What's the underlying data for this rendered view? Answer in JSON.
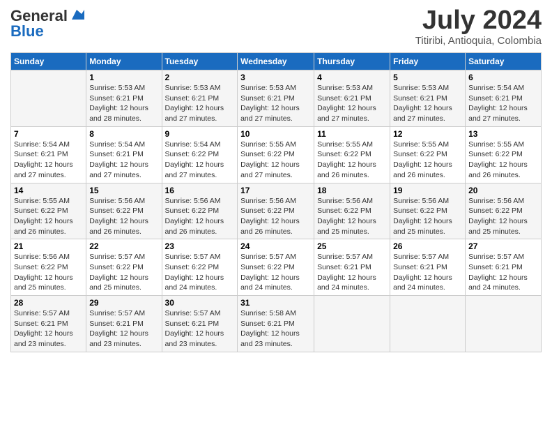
{
  "header": {
    "logo_line1": "General",
    "logo_line2": "Blue",
    "month": "July 2024",
    "location": "Titiribi, Antioquia, Colombia"
  },
  "days_of_week": [
    "Sunday",
    "Monday",
    "Tuesday",
    "Wednesday",
    "Thursday",
    "Friday",
    "Saturday"
  ],
  "weeks": [
    [
      {
        "day": "",
        "info": ""
      },
      {
        "day": "1",
        "info": "Sunrise: 5:53 AM\nSunset: 6:21 PM\nDaylight: 12 hours\nand 28 minutes."
      },
      {
        "day": "2",
        "info": "Sunrise: 5:53 AM\nSunset: 6:21 PM\nDaylight: 12 hours\nand 27 minutes."
      },
      {
        "day": "3",
        "info": "Sunrise: 5:53 AM\nSunset: 6:21 PM\nDaylight: 12 hours\nand 27 minutes."
      },
      {
        "day": "4",
        "info": "Sunrise: 5:53 AM\nSunset: 6:21 PM\nDaylight: 12 hours\nand 27 minutes."
      },
      {
        "day": "5",
        "info": "Sunrise: 5:53 AM\nSunset: 6:21 PM\nDaylight: 12 hours\nand 27 minutes."
      },
      {
        "day": "6",
        "info": "Sunrise: 5:54 AM\nSunset: 6:21 PM\nDaylight: 12 hours\nand 27 minutes."
      }
    ],
    [
      {
        "day": "7",
        "info": "Sunrise: 5:54 AM\nSunset: 6:21 PM\nDaylight: 12 hours\nand 27 minutes."
      },
      {
        "day": "8",
        "info": "Sunrise: 5:54 AM\nSunset: 6:21 PM\nDaylight: 12 hours\nand 27 minutes."
      },
      {
        "day": "9",
        "info": "Sunrise: 5:54 AM\nSunset: 6:22 PM\nDaylight: 12 hours\nand 27 minutes."
      },
      {
        "day": "10",
        "info": "Sunrise: 5:55 AM\nSunset: 6:22 PM\nDaylight: 12 hours\nand 27 minutes."
      },
      {
        "day": "11",
        "info": "Sunrise: 5:55 AM\nSunset: 6:22 PM\nDaylight: 12 hours\nand 26 minutes."
      },
      {
        "day": "12",
        "info": "Sunrise: 5:55 AM\nSunset: 6:22 PM\nDaylight: 12 hours\nand 26 minutes."
      },
      {
        "day": "13",
        "info": "Sunrise: 5:55 AM\nSunset: 6:22 PM\nDaylight: 12 hours\nand 26 minutes."
      }
    ],
    [
      {
        "day": "14",
        "info": "Sunrise: 5:55 AM\nSunset: 6:22 PM\nDaylight: 12 hours\nand 26 minutes."
      },
      {
        "day": "15",
        "info": "Sunrise: 5:56 AM\nSunset: 6:22 PM\nDaylight: 12 hours\nand 26 minutes."
      },
      {
        "day": "16",
        "info": "Sunrise: 5:56 AM\nSunset: 6:22 PM\nDaylight: 12 hours\nand 26 minutes."
      },
      {
        "day": "17",
        "info": "Sunrise: 5:56 AM\nSunset: 6:22 PM\nDaylight: 12 hours\nand 26 minutes."
      },
      {
        "day": "18",
        "info": "Sunrise: 5:56 AM\nSunset: 6:22 PM\nDaylight: 12 hours\nand 25 minutes."
      },
      {
        "day": "19",
        "info": "Sunrise: 5:56 AM\nSunset: 6:22 PM\nDaylight: 12 hours\nand 25 minutes."
      },
      {
        "day": "20",
        "info": "Sunrise: 5:56 AM\nSunset: 6:22 PM\nDaylight: 12 hours\nand 25 minutes."
      }
    ],
    [
      {
        "day": "21",
        "info": "Sunrise: 5:56 AM\nSunset: 6:22 PM\nDaylight: 12 hours\nand 25 minutes."
      },
      {
        "day": "22",
        "info": "Sunrise: 5:57 AM\nSunset: 6:22 PM\nDaylight: 12 hours\nand 25 minutes."
      },
      {
        "day": "23",
        "info": "Sunrise: 5:57 AM\nSunset: 6:22 PM\nDaylight: 12 hours\nand 24 minutes."
      },
      {
        "day": "24",
        "info": "Sunrise: 5:57 AM\nSunset: 6:22 PM\nDaylight: 12 hours\nand 24 minutes."
      },
      {
        "day": "25",
        "info": "Sunrise: 5:57 AM\nSunset: 6:21 PM\nDaylight: 12 hours\nand 24 minutes."
      },
      {
        "day": "26",
        "info": "Sunrise: 5:57 AM\nSunset: 6:21 PM\nDaylight: 12 hours\nand 24 minutes."
      },
      {
        "day": "27",
        "info": "Sunrise: 5:57 AM\nSunset: 6:21 PM\nDaylight: 12 hours\nand 24 minutes."
      }
    ],
    [
      {
        "day": "28",
        "info": "Sunrise: 5:57 AM\nSunset: 6:21 PM\nDaylight: 12 hours\nand 23 minutes."
      },
      {
        "day": "29",
        "info": "Sunrise: 5:57 AM\nSunset: 6:21 PM\nDaylight: 12 hours\nand 23 minutes."
      },
      {
        "day": "30",
        "info": "Sunrise: 5:57 AM\nSunset: 6:21 PM\nDaylight: 12 hours\nand 23 minutes."
      },
      {
        "day": "31",
        "info": "Sunrise: 5:58 AM\nSunset: 6:21 PM\nDaylight: 12 hours\nand 23 minutes."
      },
      {
        "day": "",
        "info": ""
      },
      {
        "day": "",
        "info": ""
      },
      {
        "day": "",
        "info": ""
      }
    ]
  ]
}
